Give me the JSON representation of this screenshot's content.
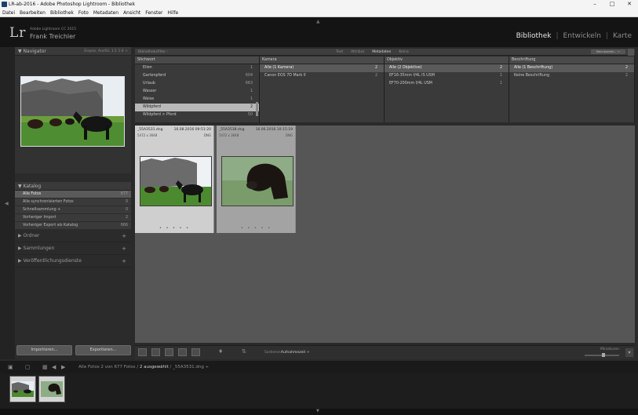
{
  "window": {
    "title": "LR-ab-2016 - Adobe Photoshop Lightroom - Bibliothek",
    "controls": [
      "–",
      "□",
      "✕"
    ]
  },
  "menu": [
    "Datei",
    "Bearbeiten",
    "Bibliothek",
    "Foto",
    "Metadaten",
    "Ansicht",
    "Fenster",
    "Hilfe"
  ],
  "identity": {
    "logo": "Lr",
    "product": "Adobe Lightroom CC 2015",
    "user": "Frank Treichler"
  },
  "modules": [
    {
      "label": "Bibliothek",
      "active": true
    },
    {
      "label": "Entwickeln",
      "active": false
    },
    {
      "label": "Karte",
      "active": false
    }
  ],
  "navigator": {
    "title": "Navigator",
    "zoom_options": "Einpas.   Ausfül.   1:1   1:4 ÷"
  },
  "catalog": {
    "title": "Katalog",
    "items": [
      {
        "label": "Alle Fotos",
        "count": "677",
        "selected": true
      },
      {
        "label": "Alle synchronisierten Fotos",
        "count": "0",
        "selected": false
      },
      {
        "label": "Schnellsammlung +",
        "count": "0",
        "selected": false
      },
      {
        "label": "Vorheriger Import",
        "count": "2",
        "selected": false
      },
      {
        "label": "Vorheriger Export als Katalog",
        "count": "666",
        "selected": false
      }
    ]
  },
  "panels": [
    {
      "label": "Ordner",
      "action": "+"
    },
    {
      "label": "Sammlungen",
      "action": "+"
    },
    {
      "label": "Veröffentlichungsdienste",
      "action": "+"
    }
  ],
  "left_buttons": {
    "import": "Importieren...",
    "export": "Exportieren..."
  },
  "filter": {
    "label": "Bibliotheksfilter :",
    "tabs": [
      {
        "label": "Text",
        "active": false
      },
      {
        "label": "Attribut",
        "active": false
      },
      {
        "label": "Metadaten",
        "active": true
      },
      {
        "label": "Keine",
        "active": false
      }
    ],
    "preset": "Benutzerde... ÷",
    "columns": [
      {
        "header": "Stichwort",
        "rows": [
          {
            "label": "Eilen",
            "count": "1",
            "state": "normal"
          },
          {
            "label": "Gartenpferd",
            "count": "604",
            "state": "normal"
          },
          {
            "label": "Urlaub",
            "count": "663",
            "state": "normal"
          },
          {
            "label": "Wasser",
            "count": "1",
            "state": "normal"
          },
          {
            "label": "Weise",
            "count": "1",
            "state": "normal"
          },
          {
            "label": "Wildpferd",
            "count": "2",
            "state": "hl"
          },
          {
            "label": "Wildpferd > Pferd",
            "count": "50",
            "state": "normal"
          }
        ]
      },
      {
        "header": "Kamera",
        "rows": [
          {
            "label": "Alle (1 Kamera)",
            "count": "2",
            "state": "sel"
          },
          {
            "label": "Canon EOS 7D Mark II",
            "count": "2",
            "state": "normal"
          }
        ]
      },
      {
        "header": "Objektiv",
        "rows": [
          {
            "label": "Alle (2 Objektive)",
            "count": "2",
            "state": "sel"
          },
          {
            "label": "EF16-35mm f/4L IS USM",
            "count": "1",
            "state": "normal"
          },
          {
            "label": "EF70-200mm f/4L USM",
            "count": "1",
            "state": "normal"
          }
        ]
      },
      {
        "header": "Beschriftung",
        "rows": [
          {
            "label": "Alle (1 Beschriftung)",
            "count": "2",
            "state": "sel"
          },
          {
            "label": "Keine Beschriftung",
            "count": "2",
            "state": "normal"
          }
        ]
      }
    ]
  },
  "grid": [
    {
      "filename": "_55A3531.dng",
      "date": "16.08.2016 09:51:20",
      "dims": "5472 x 3648",
      "ext": "DNG",
      "selected": true
    },
    {
      "filename": "_55A3538.dng",
      "date": "16.06.2016 10:15:19",
      "dims": "5472 x 3648",
      "ext": "DNG",
      "selected": false
    }
  ],
  "toolbar": {
    "sort_label": "Sortieren:",
    "sort_value": "Aufnahmezeit ÷",
    "thumbnail_label": "Miniaturen"
  },
  "filmstrip_bar": {
    "path_prefix": "Alle Fotos",
    "path_count": "2 von 677 Fotos /",
    "path_selected": "2 ausgewählt",
    "path_file": "/ _55A3531.dng ÷"
  },
  "colors": {
    "panel": "#2b2b2b",
    "selected_row": "#5a5a5a",
    "grid_bg": "#565656",
    "cell_selected": "#cfcfcf",
    "cell": "#a3a3a3",
    "identity_bg": "#141414"
  }
}
